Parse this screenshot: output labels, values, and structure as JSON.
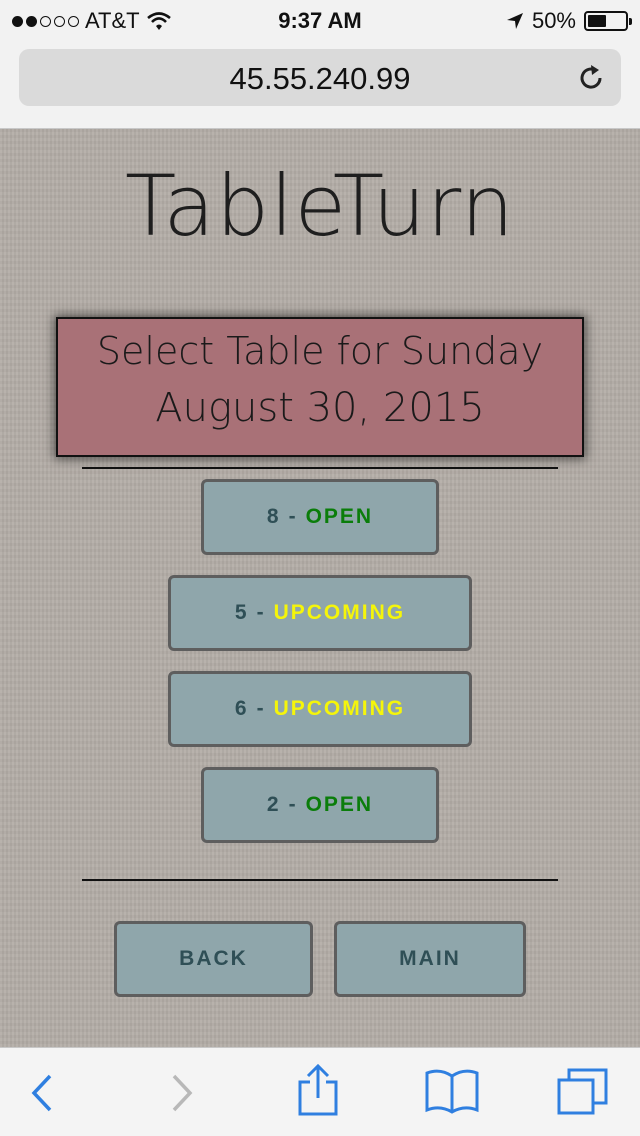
{
  "status_bar": {
    "carrier": "AT&T",
    "signal_bars_filled": 2,
    "signal_bars_total": 5,
    "time": "9:37 AM",
    "battery": "50%",
    "battery_level": 0.5,
    "icons": [
      "wifi-icon",
      "location-arrow-icon",
      "battery-icon"
    ]
  },
  "browser": {
    "url": "45.55.240.99",
    "reload_icon": "reload-icon",
    "toolbar_icons": [
      "back-arrow-icon",
      "forward-arrow-icon",
      "share-icon",
      "bookmarks-icon",
      "tabs-icon"
    ]
  },
  "app": {
    "logo": "TableTurn",
    "heading_line1": "Select Table for Sunday",
    "heading_line2": "August 30, 2015"
  },
  "tables": [
    {
      "number": "8",
      "separator": "-",
      "status": "OPEN",
      "status_color": "#0a7d0a"
    },
    {
      "number": "5",
      "separator": "-",
      "status": "UPCOMING",
      "status_color": "#f5f50a"
    },
    {
      "number": "6",
      "separator": "-",
      "status": "UPCOMING",
      "status_color": "#f5f50a"
    },
    {
      "number": "2",
      "separator": "-",
      "status": "OPEN",
      "status_color": "#0a7d0a"
    }
  ],
  "nav": {
    "back_label": "BACK",
    "main_label": "MAIN"
  },
  "colors": {
    "button_bg": "#8fa6ab",
    "heading_bg": "#a97177",
    "ios_blue": "#2f7fe0"
  }
}
